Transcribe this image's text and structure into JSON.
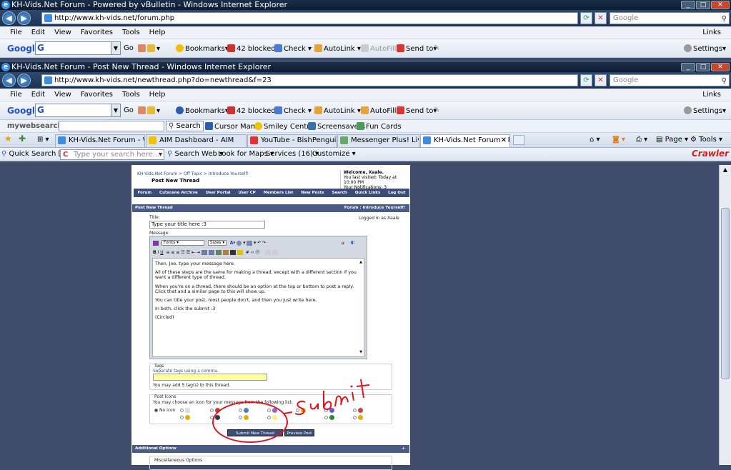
{
  "window1": {
    "title": "KH-Vids.Net Forum - Powered by vBulletin - Windows Internet Explorer",
    "address": "http://www.kh-vids.net/forum.php",
    "search_placeholder": "Google",
    "menu": [
      "File",
      "Edit",
      "View",
      "Favorites",
      "Tools",
      "Help"
    ],
    "links_label": "Links",
    "google_toolbar": {
      "logo": "Google",
      "go": "Go",
      "bookmarks": "Bookmarks",
      "blocked": "42 blocked",
      "check": "Check",
      "autolink": "AutoLink",
      "autofill": "AutoFill",
      "sendto": "Send to",
      "settings": "Settings"
    }
  },
  "window2": {
    "title": "KH-Vids.Net Forum - Post New Thread - Windows Internet Explorer",
    "address": "http://www.kh-vids.net/newthread.php?do=newthread&f=23",
    "search_placeholder": "Google",
    "menu": [
      "File",
      "Edit",
      "View",
      "Favorites",
      "Tools",
      "Help"
    ],
    "links_label": "Links",
    "google_toolbar": {
      "logo": "Google",
      "go": "Go",
      "bookmarks": "Bookmarks",
      "blocked": "42 blocked",
      "check": "Check",
      "autolink": "AutoLink",
      "autofill": "AutoFill",
      "sendto": "Send to",
      "settings": "Settings"
    }
  },
  "mywebsearch": {
    "logo": "mywebsearch",
    "search": "Search",
    "items": [
      "Cursor Mania",
      "Smiley Central",
      "Screensavers",
      "Fun Cards"
    ]
  },
  "tabs": [
    "KH-Vids.Net Forum - View...",
    "AIM Dashboard - AIM",
    "YouTube - BishPenguin's ...",
    "Messenger Plus! Live - The...",
    "KH-Vids.Net Forum - P..."
  ],
  "tab_tools": {
    "page": "Page",
    "tools": "Tools"
  },
  "quickbar": {
    "quick_search": "Quick Search [F3]",
    "placeholder": "Type your search here...",
    "search_web": "Search Web",
    "look_for_maps": "Look for Maps",
    "services": "Services (16)",
    "customize": "Customize",
    "crawler": "Crawler"
  },
  "forum": {
    "breadcrumb": "KH-Vids.Net Forum > Off Topic > Introduce Yourself!",
    "page_title": "Post New Thread",
    "welcome": "Welcome, Xaale.",
    "last_visited": "You last visited: Today at 10:00 PM",
    "notifications": "Your Notifications: 3",
    "nav": [
      "Forum",
      "Cutscene Archive",
      "User Portal",
      "User CP",
      "Members List",
      "New Posts",
      "Search",
      "Quick Links",
      "Log Out"
    ],
    "section_title": "Post New Thread",
    "section_forum": "Forum : Introduce Yourself!",
    "logged_in": "Logged in as Xaale",
    "title_label": "Title:",
    "title_value": "Type your title here :3",
    "message_label": "Message:",
    "font_select": "Fonts",
    "size_select": "Sizes",
    "message_lines": [
      "Then, Joe, type your message here.",
      "All of these steps are the same for making a thread, except with a different section if you want a different type of thread.",
      "When you're on a thread, there should be an option at the top or bottom to post a reply. Click that and a similar page to this will show up.",
      "You can title your post, most people don't, and then you just write here.",
      "In both, click the submit :3",
      "(Circled)"
    ],
    "tags_label": "Tags",
    "tags_hint": "Separate tags using a comma.",
    "tags_limit": "You may add 5 tag(s) to this thread.",
    "post_icons_label": "Post Icons",
    "post_icons_hint": "You may choose an icon for your message from the following list:",
    "no_icon": "No icon",
    "submit_btn": "Submit New Thread",
    "preview_btn": "Preview Post",
    "additional_options": "Additional Options",
    "misc_options": "Miscellaneous Options"
  },
  "annotation": {
    "text": "Submit",
    "color": "#e3131b"
  }
}
